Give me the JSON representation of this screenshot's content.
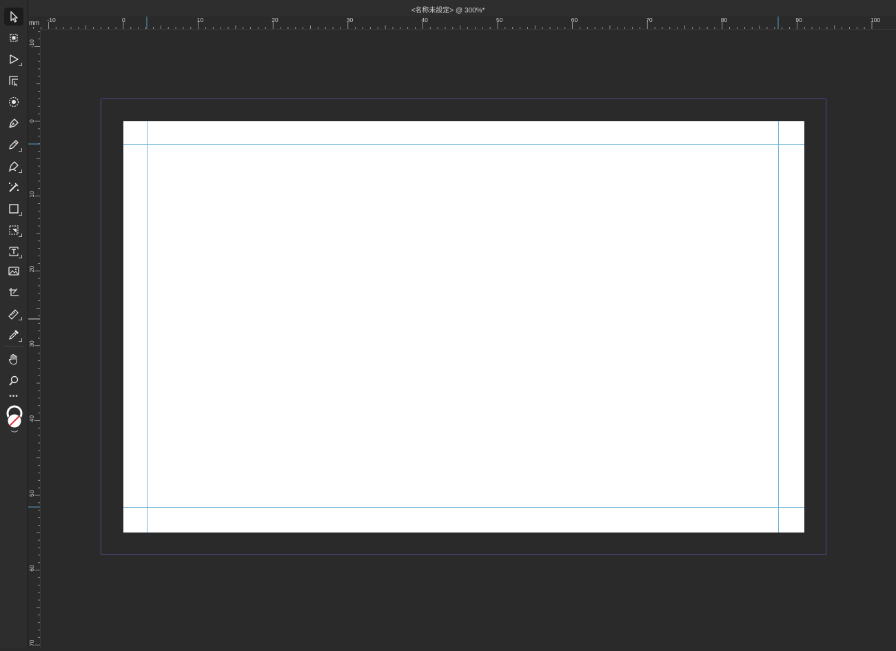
{
  "window": {
    "title": "<名称未設定> @ 300%*"
  },
  "ruler": {
    "unit": "mm",
    "horizontal_labels": [
      "-10",
      "0",
      "10",
      "20",
      "30",
      "40",
      "50",
      "60",
      "70",
      "80",
      "90",
      "100"
    ],
    "vertical_labels": [
      "-10",
      "0",
      "10",
      "20",
      "30",
      "40",
      "50",
      "60",
      "70"
    ]
  },
  "toolbar": {
    "tools": [
      {
        "name": "move-tool-icon",
        "active": true
      },
      {
        "name": "artboard-tool-icon"
      },
      {
        "name": "node-tool-icon"
      },
      {
        "name": "corner-tool-icon"
      },
      {
        "name": "point-transform-tool-icon"
      },
      {
        "name": "pen-tool-icon"
      },
      {
        "name": "pencil-tool-icon"
      },
      {
        "name": "vector-brush-tool-icon"
      },
      {
        "name": "fill-tool-icon"
      },
      {
        "name": "rectangle-tool-icon"
      },
      {
        "name": "vector-crop-tool-icon"
      },
      {
        "name": "frame-text-tool-icon"
      },
      {
        "name": "place-image-tool-icon"
      },
      {
        "name": "table-tool-icon"
      },
      {
        "name": "measure-tool-icon"
      },
      {
        "name": "color-picker-tool-icon"
      },
      {
        "name": "view-tool-icon"
      },
      {
        "name": "zoom-tool-icon"
      }
    ]
  },
  "colors": {
    "background": "#2a2a2a",
    "page": "#ffffff",
    "guide": "#71b7d9",
    "bleed": "#4d4a8a",
    "no_fill_slash": "#e0353b"
  }
}
